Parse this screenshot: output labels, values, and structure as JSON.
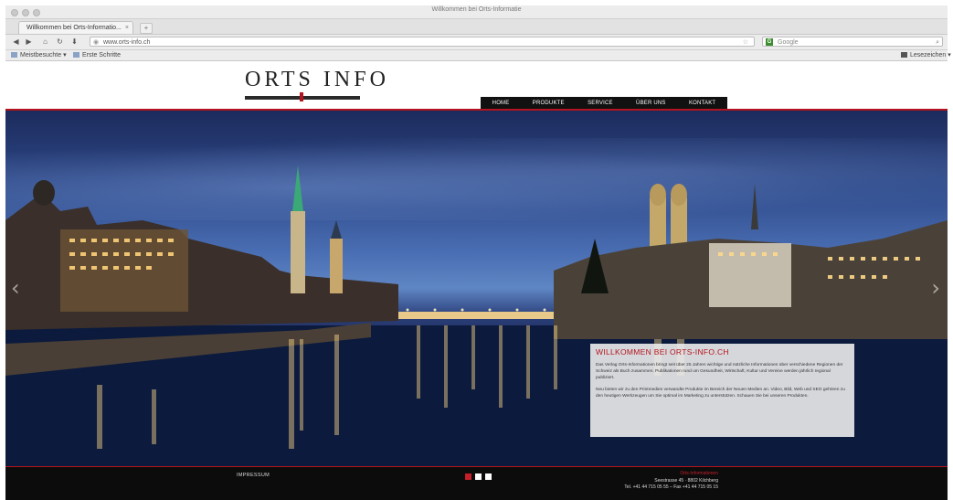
{
  "browser": {
    "window_title": "Willkommen bei Orts-Informatie",
    "tab_label": "Willkommen bei Orts-Informatio...",
    "tab_close": "×",
    "new_tab": "+",
    "url": "www.orts-info.ch",
    "search_placeholder": "Google",
    "search_engine_letter": "G",
    "bookmarks": [
      {
        "label": "Meistbesuchte ▾"
      },
      {
        "label": "Erste Schritte"
      }
    ],
    "bookmarks_right": "Lesezeichen ▾"
  },
  "site": {
    "logo_text": "ORTS INFO",
    "nav": [
      "HOME",
      "PRODUKTE",
      "SERVICE",
      "ÜBER UNS",
      "KONTAKT"
    ],
    "welcome": {
      "title": "WILLKOMMEN BEI ORTS-INFO.CH",
      "para1": "Das Verlag Orts-Informationen bringt seit über 25 Jahren wichtige und nützliche Informationen über verschiedene Regionen der Schweiz als Buch zusammen. Publikationen rund um Gesundheit, Wirtschaft, Kultur und Vereine werden jährlich regional publiziert.",
      "para2": "Neu bieten wir zu den Printmedien verwandte Produkte im Bereich der Neuen Medien an. Video, Bild, Web und SEO gehören zu den heutigen Werkzeugen um Sie optimal im Marketing zu unterstützen. Schauen Sie bei unseren Produkten."
    },
    "footer": {
      "impressum": "IMPRESSUM",
      "company": "Orts-Informationen",
      "street": "Seestrasse 45 · 8802 Kilchberg",
      "phone": "Tel. +41 44 715 05 55 – Fax +41 44 715 05 15"
    },
    "slider_dots": 3,
    "colors": {
      "accent": "#b3141d",
      "nav_bg": "#111111",
      "footer_bg": "#0c0c0c"
    }
  }
}
